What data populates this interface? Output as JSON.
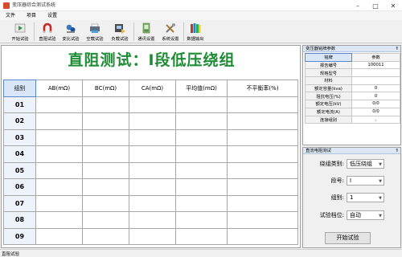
{
  "window": {
    "title": "变压器综合测试系统"
  },
  "menu": {
    "items": [
      "文件",
      "项目",
      "设置"
    ]
  },
  "toolbar": {
    "buttons": [
      {
        "label": "开始试验",
        "icon": "play-icon"
      },
      {
        "label": "直阻试验",
        "icon": "magnet-icon"
      },
      {
        "label": "变比试验",
        "icon": "transform-icon"
      },
      {
        "label": "空载试验",
        "icon": "printer-icon"
      },
      {
        "label": "负载试验",
        "icon": "load-icon"
      },
      {
        "label": "通讯设置",
        "icon": "communication-icon"
      },
      {
        "label": "系统设置",
        "icon": "tools-icon"
      },
      {
        "label": "数据输出",
        "icon": "books-icon"
      }
    ]
  },
  "main": {
    "title": "直阻测试：Ⅰ段低压绕组",
    "table": {
      "headers": [
        "组别",
        "AB(mΩ)",
        "BC(mΩ)",
        "CA(mΩ)",
        "平均值(mΩ)",
        "不平衡率(%)"
      ],
      "rows": [
        "01",
        "02",
        "03",
        "04",
        "05",
        "06",
        "07",
        "08",
        "09"
      ]
    }
  },
  "status": {
    "text": "直阻试验"
  },
  "params": {
    "title": "变压器铭牌参数",
    "headers": [
      "铭牌",
      "参数"
    ],
    "rows": [
      {
        "name": "报告编号",
        "value": "100011"
      },
      {
        "name": "规格型号",
        "value": ""
      },
      {
        "name": "材料",
        "value": ""
      },
      {
        "name": "额定容量(kva)",
        "value": "0"
      },
      {
        "name": "阻抗电压(%)",
        "value": "0"
      },
      {
        "name": "额定电压(kV)",
        "value": "0/0"
      },
      {
        "name": "额定电流(A)",
        "value": "0/0"
      },
      {
        "name": "连接组别",
        "value": ","
      }
    ]
  },
  "test_panel": {
    "title": "直流电阻测试",
    "fields": [
      {
        "label": "绕组类别:",
        "value": "低压绕组"
      },
      {
        "label": "段号:",
        "value": "Ⅰ"
      },
      {
        "label": "组别:",
        "value": "1"
      },
      {
        "label": "试验档位:",
        "value": "自动"
      }
    ],
    "start_label": "开始试验"
  },
  "colors": {
    "title_green": "#1d8c35",
    "selected_header": "#d9e6f7",
    "panel_header": "#dbe7f4"
  }
}
